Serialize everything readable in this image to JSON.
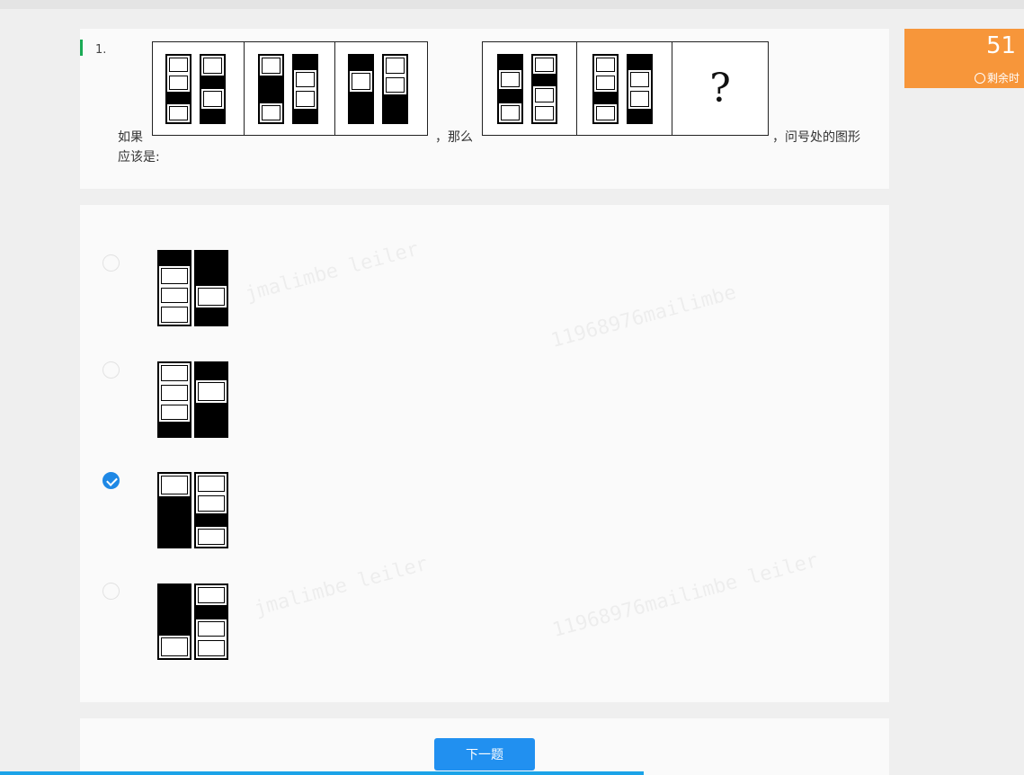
{
  "question": {
    "number": "1.",
    "text_if": "如果",
    "text_then": "，那么",
    "text_ask": "，问号处的图形",
    "text_should": "应该是:",
    "question_mark": "?"
  },
  "timer": {
    "value": "51",
    "label": "剩余时"
  },
  "options": [
    {
      "selected": false
    },
    {
      "selected": false
    },
    {
      "selected": true
    },
    {
      "selected": false
    }
  ],
  "footer": {
    "next_label": "下一题"
  },
  "colors": {
    "accent": "#1e88e5",
    "timer": "#f7963a",
    "question_marker": "#1aaa55",
    "progress": "#1ba3e8"
  }
}
